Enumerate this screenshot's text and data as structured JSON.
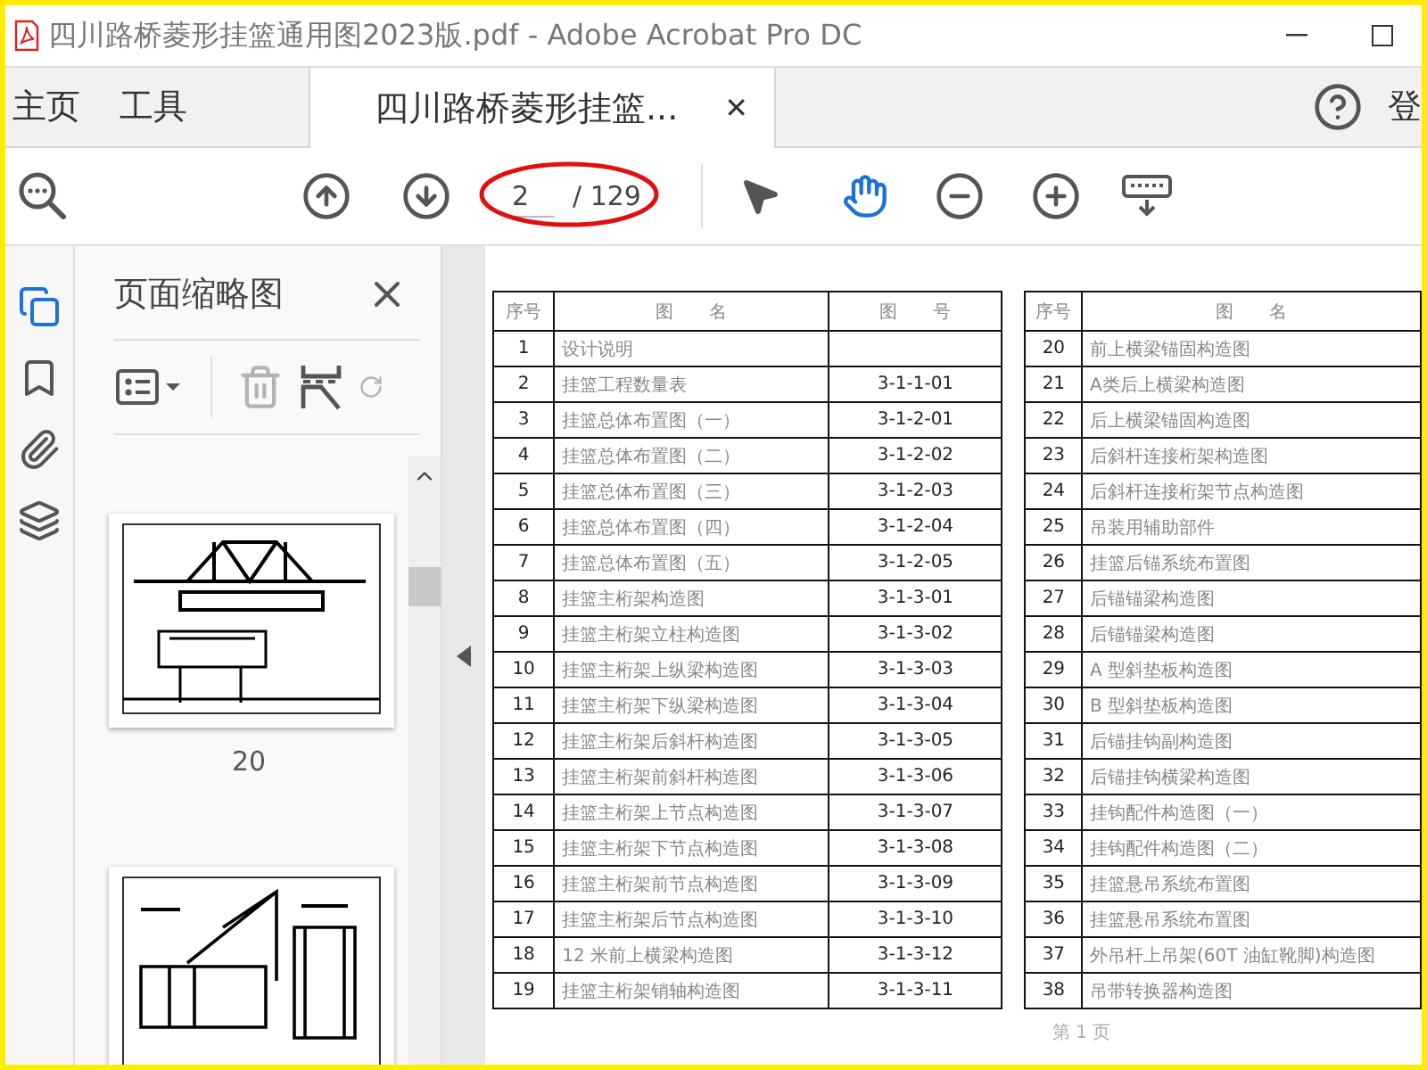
{
  "window": {
    "title": "四川路桥菱形挂篮通用图2023版.pdf - Adobe Acrobat Pro DC"
  },
  "tabs": [
    {
      "label": "主页",
      "selected": false
    },
    {
      "label": "工具",
      "selected": false
    },
    {
      "label": "四川路桥菱形挂篮...",
      "selected": true,
      "close": "✕"
    }
  ],
  "account": {
    "label": "登"
  },
  "toolbar": {
    "page": {
      "value": "2",
      "total": "/ 129"
    },
    "tools": [
      {
        "kind": "select",
        "selected": false
      },
      {
        "kind": "hand",
        "selected": true
      }
    ]
  },
  "rail": [
    {
      "kind": "pages",
      "selected": true
    },
    {
      "kind": "bookmarks",
      "selected": false
    },
    {
      "kind": "attachments",
      "selected": false
    },
    {
      "kind": "layers",
      "selected": false
    }
  ],
  "thumbnails": {
    "title": "页面缩略图",
    "pages": [
      {
        "kind": "side",
        "label": "20"
      },
      {
        "kind": "section"
      }
    ]
  },
  "document": {
    "tables": [
      {
        "columns": [
          "序号",
          "图　　名",
          "图　　号"
        ],
        "rows": [
          [
            "1",
            "设计说明",
            ""
          ],
          [
            "2",
            "挂篮工程数量表",
            "3-1-1-01"
          ],
          [
            "3",
            "挂篮总体布置图（一）",
            "3-1-2-01"
          ],
          [
            "4",
            "挂篮总体布置图（二）",
            "3-1-2-02"
          ],
          [
            "5",
            "挂篮总体布置图（三）",
            "3-1-2-03"
          ],
          [
            "6",
            "挂篮总体布置图（四）",
            "3-1-2-04"
          ],
          [
            "7",
            "挂篮总体布置图（五）",
            "3-1-2-05"
          ],
          [
            "8",
            "挂篮主桁架构造图",
            "3-1-3-01"
          ],
          [
            "9",
            "挂篮主桁架立柱构造图",
            "3-1-3-02"
          ],
          [
            "10",
            "挂篮主桁架上纵梁构造图",
            "3-1-3-03"
          ],
          [
            "11",
            "挂篮主桁架下纵梁构造图",
            "3-1-3-04"
          ],
          [
            "12",
            "挂篮主桁架后斜杆构造图",
            "3-1-3-05"
          ],
          [
            "13",
            "挂篮主桁架前斜杆构造图",
            "3-1-3-06"
          ],
          [
            "14",
            "挂篮主桁架上节点构造图",
            "3-1-3-07"
          ],
          [
            "15",
            "挂篮主桁架下节点构造图",
            "3-1-3-08"
          ],
          [
            "16",
            "挂篮主桁架前节点构造图",
            "3-1-3-09"
          ],
          [
            "17",
            "挂篮主桁架后节点构造图",
            "3-1-3-10"
          ],
          [
            "18",
            "12 米前上横梁构造图",
            "3-1-3-12"
          ],
          [
            "19",
            "挂篮主桁架销轴构造图",
            "3-1-3-11"
          ]
        ]
      },
      {
        "columns": [
          "序号",
          "图　　名"
        ],
        "rows": [
          [
            "20",
            "前上横梁锚固构造图"
          ],
          [
            "21",
            "A类后上横梁构造图"
          ],
          [
            "22",
            "后上横梁锚固构造图"
          ],
          [
            "23",
            "后斜杆连接桁架构造图"
          ],
          [
            "24",
            "后斜杆连接桁架节点构造图"
          ],
          [
            "25",
            "吊装用辅助部件"
          ],
          [
            "26",
            "挂篮后锚系统布置图"
          ],
          [
            "27",
            "后锚锚梁构造图"
          ],
          [
            "28",
            "后锚锚梁构造图"
          ],
          [
            "29",
            "A 型斜垫板构造图"
          ],
          [
            "30",
            "B 型斜垫板构造图"
          ],
          [
            "31",
            "后锚挂钩副构造图"
          ],
          [
            "32",
            "后锚挂钩横梁构造图"
          ],
          [
            "33",
            "挂钩配件构造图（一）"
          ],
          [
            "34",
            "挂钩配件构造图（二）"
          ],
          [
            "35",
            "挂篮悬吊系统布置图"
          ],
          [
            "36",
            "挂篮悬吊系统布置图"
          ],
          [
            "37",
            "外吊杆上吊架(60T 油缸靴脚)构造图"
          ],
          [
            "38",
            "吊带转换器构造图"
          ]
        ]
      }
    ],
    "footer": "第 1 页"
  }
}
